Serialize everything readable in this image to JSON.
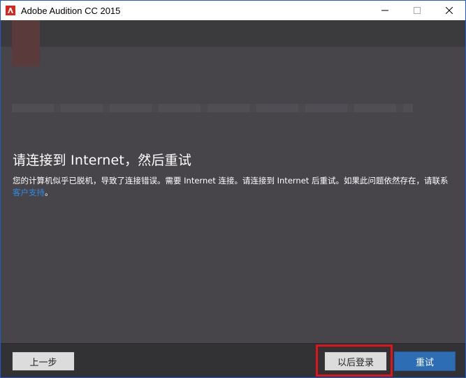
{
  "window": {
    "title": "Adobe Audition CC 2015"
  },
  "content": {
    "heading": "请连接到 Internet，然后重试",
    "message_before_link": "您的计算机似乎已脱机，导致了连接错误。需要 Internet 连接。请连接到 Internet 后重试。如果此问题依然存在，请联系",
    "link_text": "客户支持",
    "message_after_link": "。"
  },
  "footer": {
    "back_label": "上一步",
    "later_label": "以后登录",
    "retry_label": "重试"
  },
  "colors": {
    "accent": "#2d6db4",
    "link": "#2d8ceb",
    "highlight": "#e0141b",
    "background": "#474549"
  }
}
